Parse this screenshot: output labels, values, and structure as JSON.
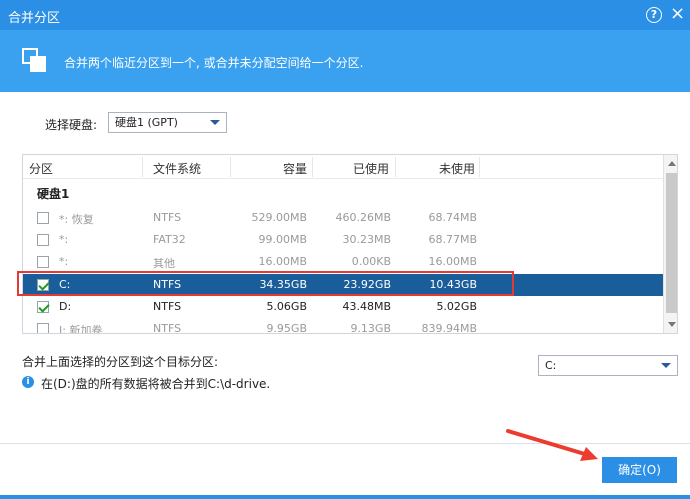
{
  "window": {
    "title": "合并分区",
    "help_icon": "question-icon",
    "close_icon": "close-icon"
  },
  "banner": {
    "description": "合并两个临近分区到一个, 或合并未分配空间给一个分区.",
    "icon": "merge-partition-icon"
  },
  "disk_select": {
    "label": "选择硬盘:",
    "value": "硬盘1 (GPT)"
  },
  "table": {
    "columns": [
      "分区",
      "文件系统",
      "容量",
      "已使用",
      "未使用"
    ],
    "group_label": "硬盘1",
    "rows": [
      {
        "name": "*: 恢复",
        "fs": "NTFS",
        "capacity": "529.00MB",
        "used": "460.26MB",
        "free": "68.74MB",
        "checked": false,
        "dim": true
      },
      {
        "name": "*:",
        "fs": "FAT32",
        "capacity": "99.00MB",
        "used": "30.23MB",
        "free": "68.77MB",
        "checked": false,
        "dim": true
      },
      {
        "name": "*:",
        "fs": "其他",
        "capacity": "16.00MB",
        "used": "0.00KB",
        "free": "16.00MB",
        "checked": false,
        "dim": true
      },
      {
        "name": "C:",
        "fs": "NTFS",
        "capacity": "34.35GB",
        "used": "23.92GB",
        "free": "10.43GB",
        "checked": true,
        "selected": true
      },
      {
        "name": "D:",
        "fs": "NTFS",
        "capacity": "5.06GB",
        "used": "43.48MB",
        "free": "5.02GB",
        "checked": true
      },
      {
        "name": "I: 新加卷",
        "fs": "NTFS",
        "capacity": "9.95GB",
        "used": "9.13GB",
        "free": "839.94MB",
        "checked": false,
        "dim": true
      }
    ]
  },
  "target": {
    "label": "合并上面选择的分区到这个目标分区:",
    "value": "C:"
  },
  "info": {
    "text": "在(D:)盘的所有数据将被合并到C:\\d-drive."
  },
  "buttons": {
    "ok_label": "确定(O)"
  },
  "colors": {
    "accent": "#2b8fe6",
    "banner": "#3aa0f0",
    "selected_row": "#1a5d9b",
    "highlight": "#e53935"
  }
}
